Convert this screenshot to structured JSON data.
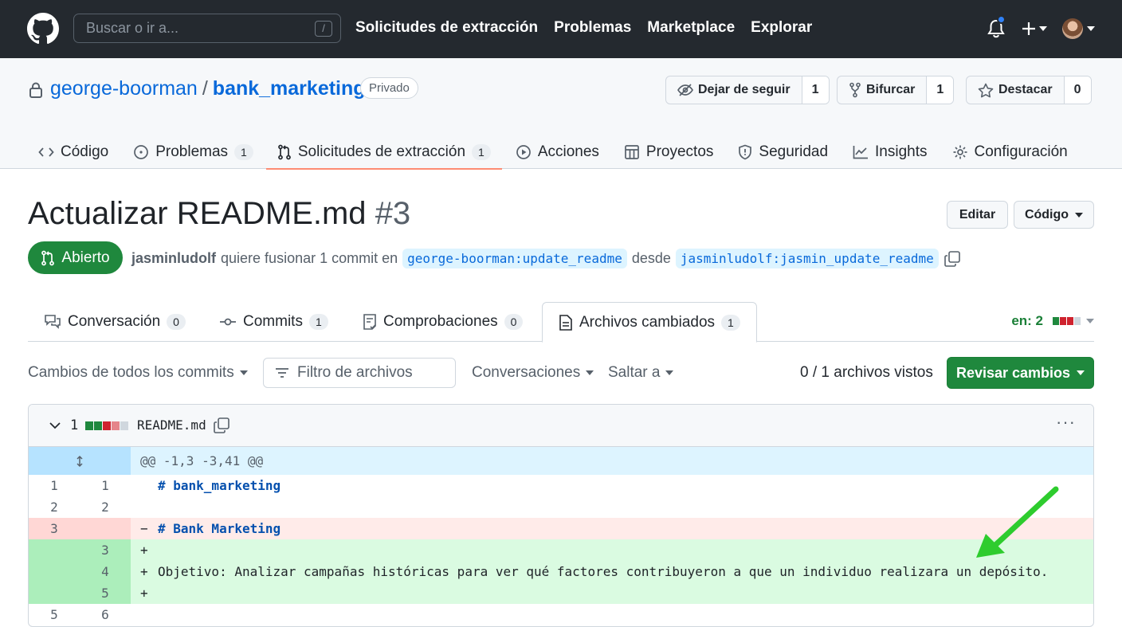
{
  "header": {
    "search_placeholder": "Buscar o ir a...",
    "search_shortcut": "/",
    "nav": [
      "Solicitudes de extracción",
      "Problemas",
      "Marketplace",
      "Explorar"
    ],
    "icons": [
      "github-logo-icon",
      "bell-icon",
      "plus-icon",
      "avatar"
    ]
  },
  "repo": {
    "owner": "george-boorman",
    "separator": "/",
    "name": "bank_marketing",
    "visibility": "Privado",
    "watch_label": "Dejar de seguir",
    "watch_count": "1",
    "fork_label": "Bifurcar",
    "fork_count": "1",
    "star_label": "Destacar",
    "star_count": "0",
    "tabs": [
      {
        "label": "Código",
        "count": ""
      },
      {
        "label": "Problemas",
        "count": "1"
      },
      {
        "label": "Solicitudes de extracción",
        "count": "1"
      },
      {
        "label": "Acciones",
        "count": ""
      },
      {
        "label": "Proyectos",
        "count": ""
      },
      {
        "label": "Seguridad",
        "count": ""
      },
      {
        "label": "Insights",
        "count": ""
      },
      {
        "label": "Configuración",
        "count": ""
      }
    ]
  },
  "pr": {
    "title": "Actualizar README.md",
    "number": "#3",
    "edit_label": "Editar",
    "code_label": "Código",
    "state": "Abierto",
    "author": "jasminludolf",
    "meta_text": "quiere fusionar 1 commit en",
    "base_branch": "george-boorman:update_readme",
    "from_text": "desde",
    "head_branch": "jasminludolf:jasmin_update_readme",
    "tabs": [
      {
        "label": "Conversación",
        "count": "0"
      },
      {
        "label": "Commits",
        "count": "1"
      },
      {
        "label": "Comprobaciones",
        "count": "0"
      },
      {
        "label": "Archivos cambiados",
        "count": "1"
      }
    ],
    "diffstat_label": "en: 2"
  },
  "toolbar": {
    "changes_from": "Cambios de todos los commits",
    "filter_placeholder": "Filtro de archivos",
    "conversations": "Conversaciones",
    "jump_to": "Saltar a",
    "viewed": "0 / 1 archivos vistos",
    "review_label": "Revisar cambios"
  },
  "file": {
    "changes": "1",
    "name": "README.md",
    "hunk": "@@ -1,3 -3,41 @@",
    "lines": [
      {
        "old": "1",
        "new": "1",
        "type": "ctx",
        "sign": " ",
        "text": "# bank_marketing"
      },
      {
        "old": "2",
        "new": "2",
        "type": "ctx",
        "sign": " ",
        "text": ""
      },
      {
        "old": "3",
        "new": "",
        "type": "del",
        "sign": "−",
        "text": "# Bank Marketing"
      },
      {
        "old": "",
        "new": "3",
        "type": "add",
        "sign": "+",
        "text": ""
      },
      {
        "old": "",
        "new": "4",
        "type": "add",
        "sign": "+",
        "text": "Objetivo: Analizar campañas históricas para ver qué factores contribuyeron a que un individuo realizara un depósito."
      },
      {
        "old": "",
        "new": "5",
        "type": "add",
        "sign": "+",
        "text": ""
      },
      {
        "old": "5",
        "new": "6",
        "type": "ctx",
        "sign": " ",
        "text": ""
      }
    ]
  },
  "colors": {
    "accent": "#0969da",
    "green": "#1f883d",
    "header_bg": "#24292f",
    "tab_underline": "#fd8c73",
    "annotation_arrow": "#2ecc2e"
  }
}
